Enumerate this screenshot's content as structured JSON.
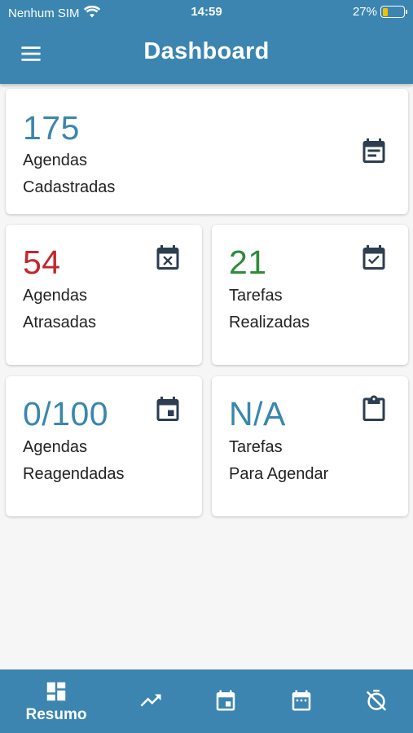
{
  "status_bar": {
    "carrier": "Nenhum SIM",
    "time": "14:59",
    "battery_text": "27%",
    "battery_level": 0.27,
    "icons": [
      "wifi-icon",
      "battery-icon"
    ]
  },
  "app_bar": {
    "title": "Dashboard",
    "menu_icon": "hamburger-menu-icon"
  },
  "colors": {
    "primary": "#3b85b0",
    "value_blue": "#3a86ad",
    "value_red": "#c1272d",
    "value_green": "#2e8b3a",
    "icon_dark": "#2d3e50",
    "battery_yellow": "#f2c200"
  },
  "cards": {
    "agendas_cadastradas": {
      "value": "175",
      "label": "Agendas\nCadastradas",
      "icon": "event-note-icon"
    },
    "agendas_atrasadas": {
      "value": "54",
      "label": "Agendas\nAtrasadas",
      "icon": "event-busy-icon"
    },
    "tarefas_realizadas": {
      "value": "21",
      "label": "Tarefas\nRealizadas",
      "icon": "event-available-icon"
    },
    "agendas_reagendadas": {
      "value": "0/100",
      "label": "Agendas\nReagendadas",
      "icon": "event-today-icon"
    },
    "tarefas_para_agendar": {
      "value": "N/A",
      "label": "Tarefas\nPara Agendar",
      "icon": "clipboard-icon"
    }
  },
  "bottom_nav": {
    "items": [
      {
        "label": "Resumo",
        "icon": "dashboard-grid-icon",
        "active": true
      },
      {
        "label": "",
        "icon": "trending-up-icon"
      },
      {
        "label": "",
        "icon": "calendar-today-icon"
      },
      {
        "label": "",
        "icon": "calendar-month-icon"
      },
      {
        "label": "",
        "icon": "timer-off-icon"
      }
    ]
  }
}
